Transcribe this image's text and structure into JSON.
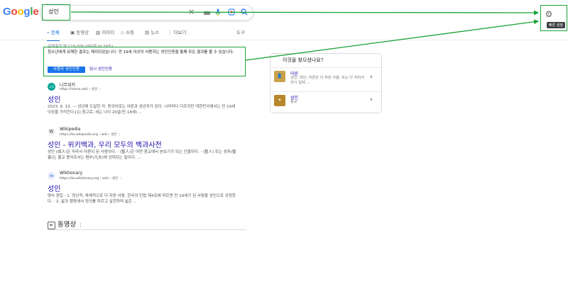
{
  "logo": {
    "g1": "G",
    "o1": "o",
    "o2": "o",
    "g2": "g",
    "l": "l",
    "e": "e"
  },
  "search": {
    "query": "성인",
    "clear_icon": "×",
    "mic_icon": "mic-icon",
    "lens_icon": "lens-icon",
    "search_icon": "search-icon"
  },
  "settings": {
    "icon": "gear-icon",
    "tooltip": "빠른 설정"
  },
  "tabs": [
    {
      "label": "전체",
      "icon": "search-icon"
    },
    {
      "label": "동영상",
      "icon": "video-icon"
    },
    {
      "label": "이미지",
      "icon": "image-icon"
    },
    {
      "label": "쇼핑",
      "icon": "shopping-icon"
    },
    {
      "label": "뉴스",
      "icon": "news-icon"
    },
    {
      "label": "더보기",
      "icon": "more-icon"
    }
  ],
  "tools": "도구",
  "stats": "검색결과 약 119,000,000개 (0.29초)",
  "notice": {
    "text": "청소년에게 유해한 결과는 제외되었습니다. 만 19세 이상의 사용자는 성인인증을 통해 모든 결과를 볼 수 있습니다.",
    "verify_button": "사용자 성인인증",
    "temp_link": "임시 성인인증"
  },
  "results": [
    {
      "favicon": "나무",
      "site": "나무위키",
      "url": "https://namu.wiki › 성인",
      "title": "성인",
      "snippet": "2023. 9. 13. — 성년에 도달한 자. 동의어로는 어른과 성년자가 있다. 나라마다 다르지만 대한민국에서는 만 19세 이상을 가리킨다.[1] 참고로, 세는 나이 20살(만 18세) ..."
    },
    {
      "favicon": "W",
      "site": "Wikipedia",
      "url": "https://ko.wikipedia.org › wiki › 성인",
      "title": "성인 - 위키백과, 우리 모두의 백과사전",
      "snippet": "성인 (成人)은 자라서 어른이 된 사람이다. · (聖人)은 어떤 종교에서 본보기가 되는 인물이다. · (聖人) 또는 성자(聖者)는 불교 용어로서는 범부(凡夫)에 상대되는 말이다. ..."
    },
    {
      "favicon": "Wt",
      "site": "Wiktionary",
      "url": "https://ko.wiktionary.org › wiki › 성인",
      "title": "성인",
      "snippet": "명사 편집 · 1. 정신적, 육체적으로 다 자란 사람. 한국의 민법 제4조에 따르면 만 19세가 된 사람을 성인으로 규정한다. · 2. 삶과 행동에서 정의를 따르고 실천하며 넓은 ..."
    }
  ],
  "video_section": "동영상",
  "panel": {
    "title": "이것을 찾으셨나요?",
    "items": [
      {
        "name": "어른",
        "desc": "성인, 대인, 어른은 다 자란 사람, 또는 다 자라서 자기 일에 ..."
      },
      {
        "name": "성인",
        "desc": "종교"
      }
    ]
  },
  "colors": {
    "accent": "#1a73e8",
    "link": "#1a0dab",
    "highlight": "#19a339"
  }
}
